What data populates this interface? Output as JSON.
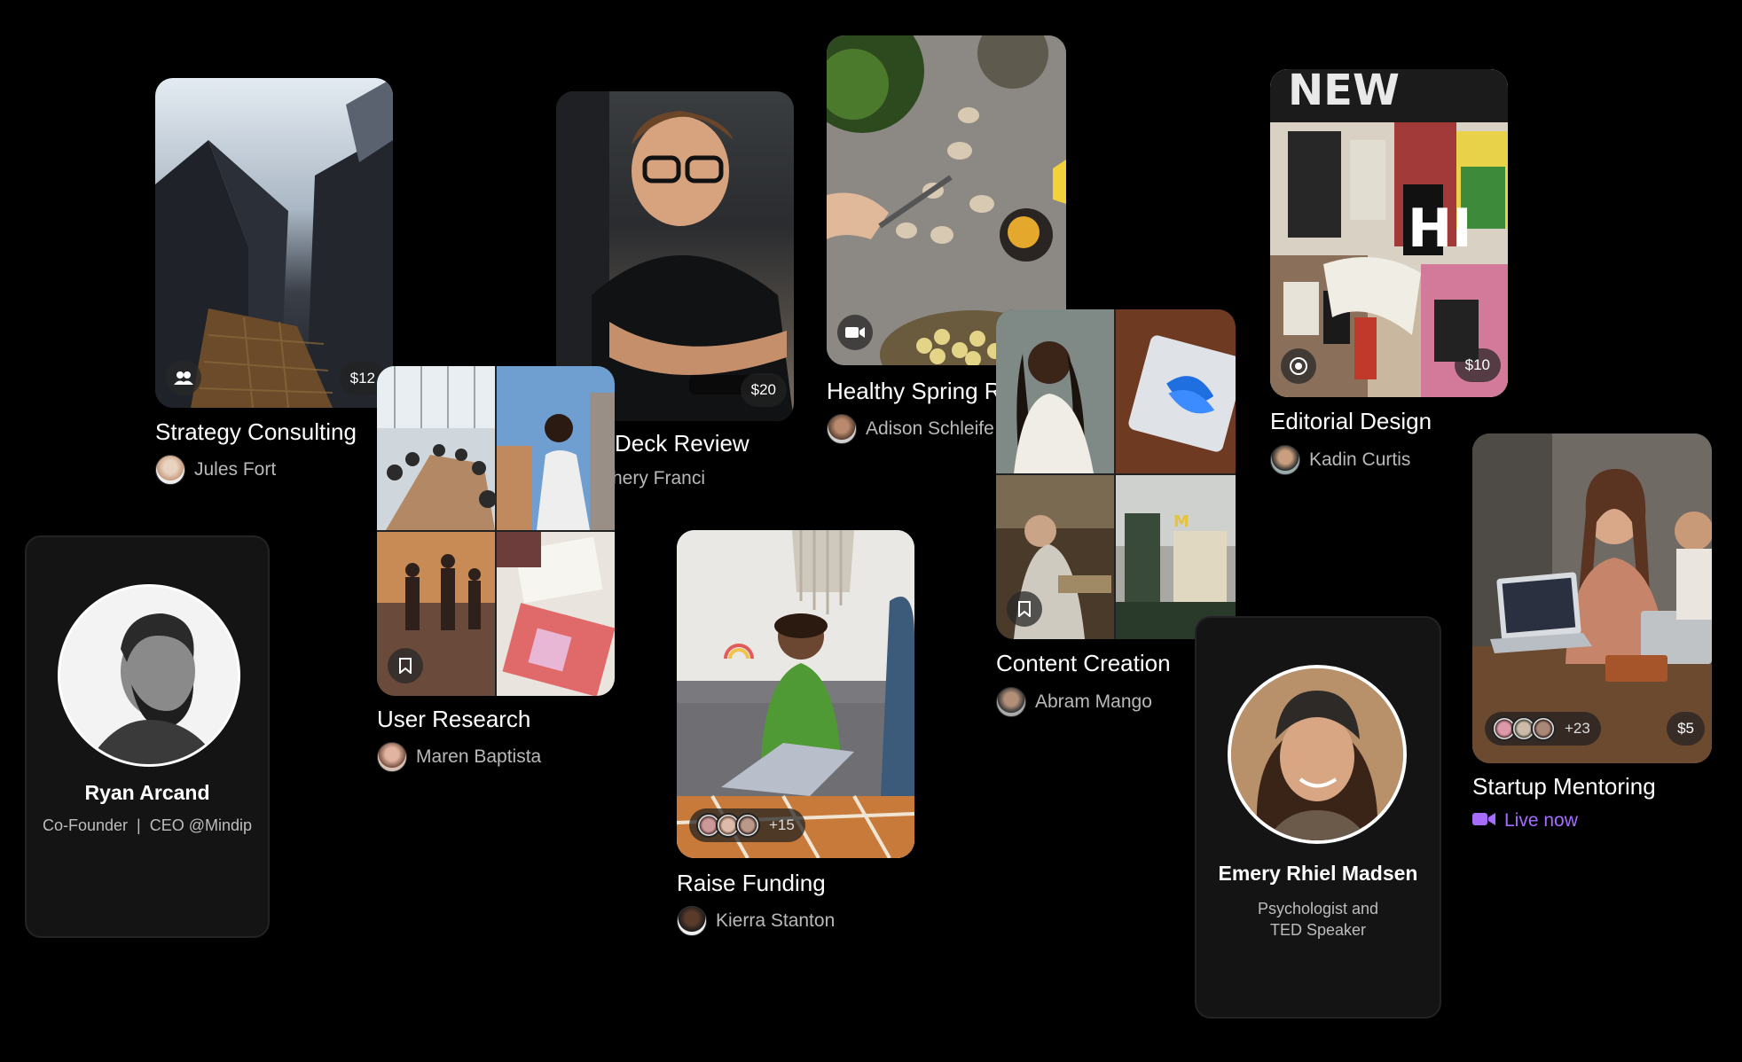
{
  "cards": {
    "strategy": {
      "title": "Strategy Consulting",
      "author": "Jules Fort",
      "price": "$12",
      "icon": "group-icon"
    },
    "deck": {
      "title": "Deck Review",
      "author": "hery Franci",
      "price": "$20"
    },
    "healthy": {
      "title": "Healthy Spring Re",
      "author": "Adison Schleife",
      "icon": "video-icon"
    },
    "editorial": {
      "title": "Editorial Design",
      "author": "Kadin Curtis",
      "price": "$10",
      "icon": "webcam-icon"
    },
    "user_research": {
      "title": "User Research",
      "author": "Maren Baptista",
      "icon": "bookmark-icon"
    },
    "raise": {
      "title": "Raise Funding",
      "author": "Kierra Stanton",
      "count": "+15"
    },
    "content": {
      "title": "Content Creation",
      "author": "Abram Mango",
      "icon": "bookmark-icon"
    },
    "startup": {
      "title": "Startup Mentoring",
      "status": "Live now",
      "count": "+23",
      "price": "$5"
    }
  },
  "profiles": {
    "ryan": {
      "name": "Ryan Arcand",
      "role": "Co-Founder  |  CEO @Mindip"
    },
    "emery": {
      "name": "Emery Rhiel Madsen",
      "role_line1": "Psychologist and",
      "role_line2": "TED Speaker"
    }
  },
  "colors": {
    "background": "#000000",
    "live": "#a66cff",
    "card_bg": "#141415"
  }
}
